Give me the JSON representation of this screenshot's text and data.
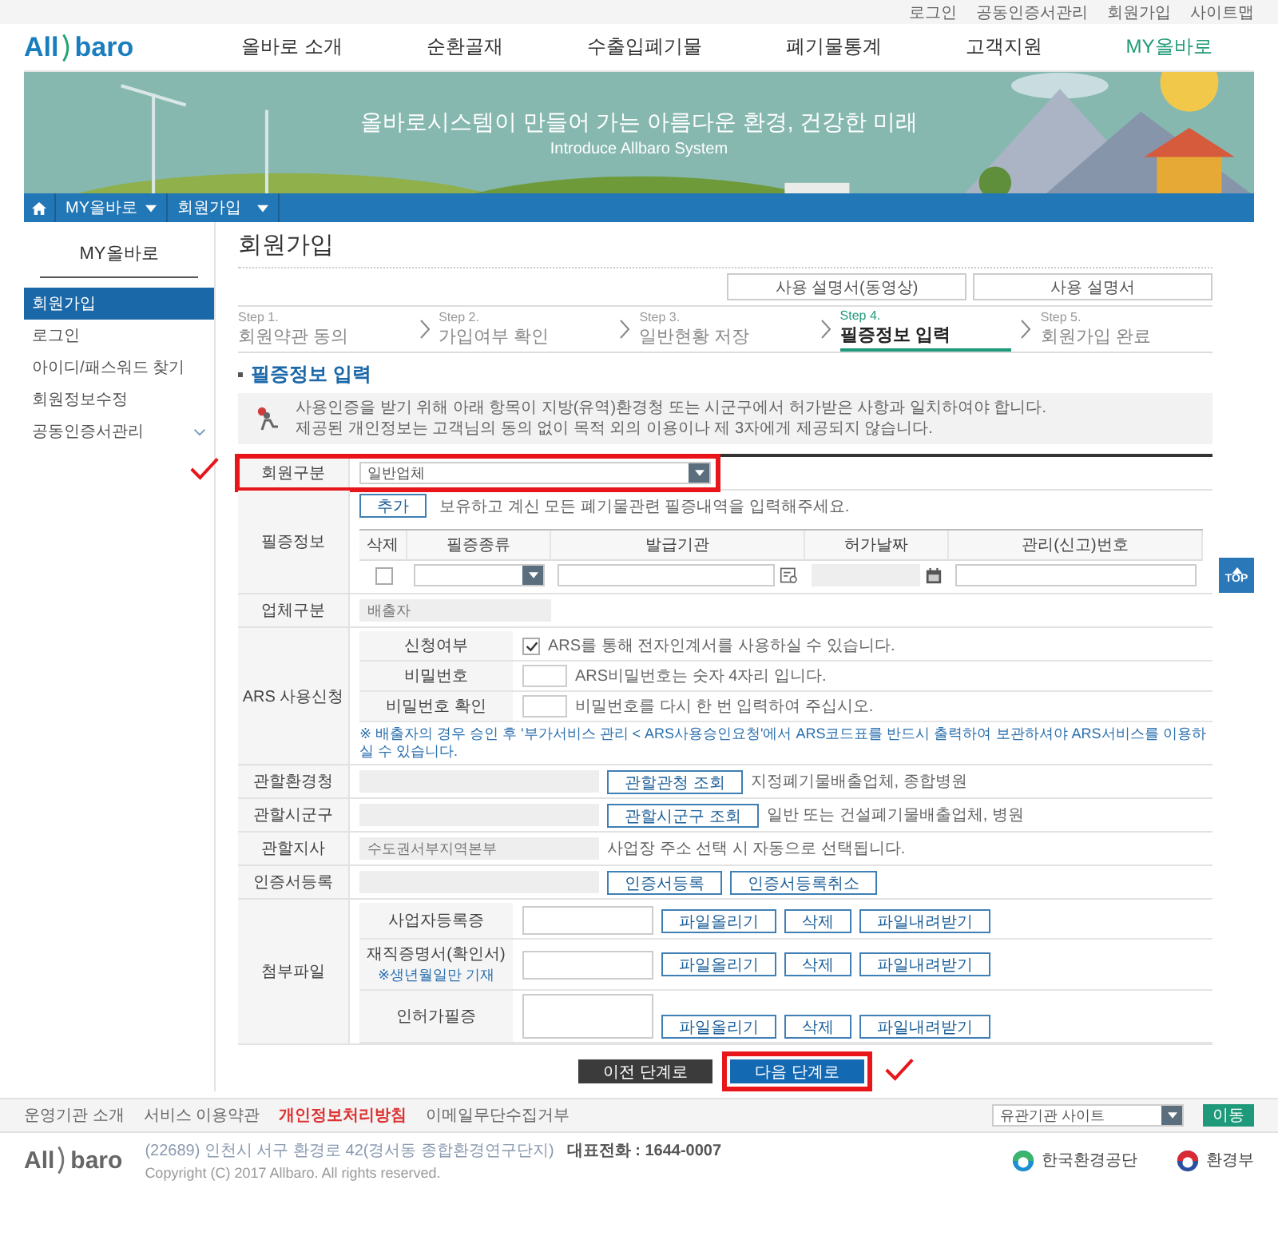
{
  "utility_links": [
    "로그인",
    "공동인증서관리",
    "회원가입",
    "사이트맵"
  ],
  "logo": {
    "left": "All",
    "right": "baro"
  },
  "nav": [
    {
      "label": "올바로 소개",
      "selected": false
    },
    {
      "label": "순환골재",
      "selected": false
    },
    {
      "label": "수출입폐기물",
      "selected": false
    },
    {
      "label": "폐기물통계",
      "selected": false
    },
    {
      "label": "고객지원",
      "selected": false
    },
    {
      "label": "MY올바로",
      "selected": true
    }
  ],
  "banner": {
    "title": "올바로시스템이 만들어 가는 아름다운 환경, 건강한 미래",
    "subtitle": "Introduce Allbaro System"
  },
  "breadcrumb": [
    "MY올바로",
    "회원가입"
  ],
  "sidebar": {
    "title": "MY올바로",
    "items": [
      {
        "label": "회원가입",
        "selected": true,
        "has_submenu": false
      },
      {
        "label": "로그인",
        "selected": false,
        "has_submenu": false
      },
      {
        "label": "아이디/패스워드 찾기",
        "selected": false,
        "has_submenu": false
      },
      {
        "label": "회원정보수정",
        "selected": false,
        "has_submenu": false
      },
      {
        "label": "공동인증서관리",
        "selected": false,
        "has_submenu": true
      }
    ]
  },
  "page_title": "회원가입",
  "manual_buttons": [
    "사용 설명서(동영상)",
    "사용 설명서"
  ],
  "steps": [
    {
      "step": "Step 1.",
      "label": "회원약관 동의",
      "selected": false
    },
    {
      "step": "Step 2.",
      "label": "가입여부 확인",
      "selected": false
    },
    {
      "step": "Step 3.",
      "label": "일반현황 저장",
      "selected": false
    },
    {
      "step": "Step 4.",
      "label": "필증정보 입력",
      "selected": true
    },
    {
      "step": "Step 5.",
      "label": "회원가입 완료",
      "selected": false
    }
  ],
  "section_title": "필증정보 입력",
  "notice": [
    "사용인증을 받기 위해 아래 항목이 지방(유역)환경청 또는 시군구에서 허가받은 사항과 일치하여야 합니다.",
    "제공된 개인정보는 고객님의 동의 없이 목적 외의 이용이나 제 3자에게 제공되지 않습니다."
  ],
  "form": {
    "member_type": {
      "label": "회원구분",
      "value": "일반업체"
    },
    "permits": {
      "label": "필증정보",
      "add_button": "추가",
      "hint": "보유하고 계신 모든 폐기물관련 필증내역을 입력해주세요.",
      "columns": [
        "삭제",
        "필증종류",
        "발급기관",
        "허가날짜",
        "관리(신고)번호"
      ],
      "rows": [
        {
          "checked": false
        }
      ]
    },
    "company_type": {
      "label": "업체구분",
      "value": "배출자"
    },
    "ars": {
      "label": "ARS 사용신청",
      "apply": {
        "label": "신청여부",
        "checked": true,
        "text": "ARS를 통해 전자인계서를 사용하실 수 있습니다."
      },
      "password": {
        "label": "비밀번호",
        "hint": "ARS비밀번호는 숫자 4자리 입니다."
      },
      "password_confirm": {
        "label": "비밀번호 확인",
        "hint": "비밀번호를 다시 한 번 입력하여 주십시오."
      },
      "note": "※ 배출자의 경우 승인 후 '부가서비스 관리 < ARS사용승인요청'에서 ARS코드표를 반드시 출력하여 보관하셔야 ARS서비스를 이용하실 수 있습니다."
    },
    "lookups": [
      {
        "label": "관할환경청",
        "buttons": [
          "관할관청 조회"
        ],
        "hint": "지정폐기물배출업체, 종합병원"
      },
      {
        "label": "관할시군구",
        "buttons": [
          "관할시군구 조회"
        ],
        "hint": "일반 또는 건설폐기물배출업체, 병원"
      },
      {
        "label": "관할지사",
        "value": "수도권서부지역본부",
        "hint": "사업장 주소 선택 시 자동으로 선택됩니다."
      },
      {
        "label": "인증서등록",
        "buttons": [
          "인증서등록",
          "인증서등록취소"
        ]
      }
    ],
    "attachments": {
      "label": "첨부파일",
      "files": [
        {
          "name": "사업자등록증",
          "kind": "single",
          "buttons": [
            "파일올리기",
            "삭제",
            "파일내려받기"
          ]
        },
        {
          "name": "재직증명서(확인서)",
          "note": "※생년월일만 기재",
          "kind": "single",
          "buttons": [
            "파일올리기",
            "삭제",
            "파일내려받기"
          ]
        },
        {
          "name": "인허가필증",
          "kind": "multiple",
          "buttons": [
            "파일올리기",
            "삭제",
            "파일내려받기"
          ]
        }
      ]
    }
  },
  "actions": [
    {
      "label": "이전 단계로",
      "kind": "secondary"
    },
    {
      "label": "다음 단계로",
      "kind": "primary"
    }
  ],
  "top_button": "TOP",
  "footer_links": [
    {
      "label": "운영기관 소개",
      "highlighted": false
    },
    {
      "label": "서비스 이용약관",
      "highlighted": false
    },
    {
      "label": "개인정보처리방침",
      "highlighted": true
    },
    {
      "label": "이메일무단수집거부",
      "highlighted": false
    }
  ],
  "site_select": {
    "value": "유관기관 사이트",
    "button": "이동"
  },
  "footer": {
    "logo": {
      "left": "All",
      "right": "baro"
    },
    "address": "(22689) 인천시 서구 환경로 42(경서동 종합환경연구단지)",
    "phone": "대표전화 : 1644-0007",
    "copyright": "Copyright (C) 2017 Allbaro. All rights reserved.",
    "agencies": [
      "한국환경공단",
      "환경부"
    ]
  }
}
